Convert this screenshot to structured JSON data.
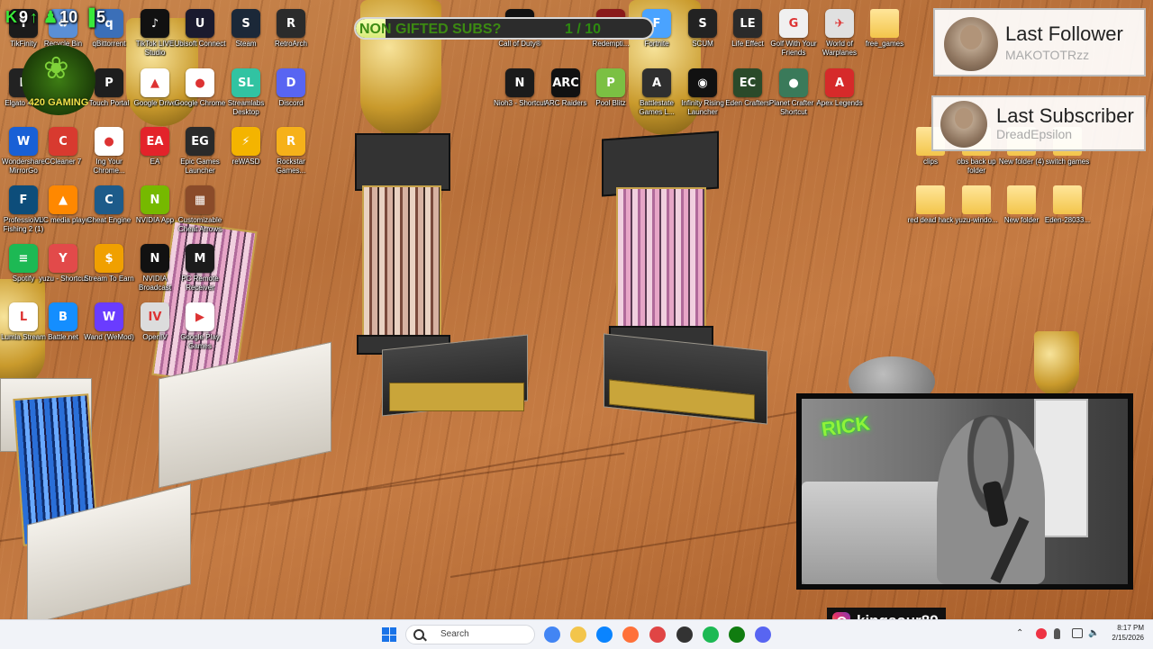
{
  "stream_stats": [
    {
      "symbol": "K",
      "value": "9",
      "icon": "up-arrow-icon"
    },
    {
      "symbol": "♟",
      "value": "10",
      "icon": "person-icon"
    },
    {
      "symbol": "▐",
      "value": "5",
      "icon": "bars-icon"
    }
  ],
  "sub_goal": {
    "title": "NON GIFTED SUBS?",
    "count_text": "1 / 10",
    "current": 1,
    "target": 10
  },
  "last_follower": {
    "heading": "Last Follower",
    "name": "MAKOTOTRzz"
  },
  "last_subscriber": {
    "heading": "Last Subscriber",
    "name": "DreadEpsilon"
  },
  "overlay_logo_text": "420 GAMING",
  "cam_tag": "RICK",
  "instagram": {
    "handle": "kingsour89"
  },
  "desktop_icons": [
    {
      "label": "TikFinity",
      "color": "#1b1b1b",
      "glyph": "T"
    },
    {
      "label": "Recycle Bin",
      "color": "#5a8fd6",
      "glyph": "♻"
    },
    {
      "label": "qBittorrent",
      "color": "#3b6fb8",
      "glyph": "q"
    },
    {
      "label": "TikTok LIVE Studio",
      "color": "#111111",
      "glyph": "♪"
    },
    {
      "label": "Ubisoft Connect",
      "color": "#1a1a2e",
      "glyph": "U"
    },
    {
      "label": "Steam",
      "color": "#1b2838",
      "glyph": "S"
    },
    {
      "label": "RetroArch",
      "color": "#2b2b2b",
      "glyph": "R"
    },
    {
      "label": "Elgato 4K...",
      "color": "#222222",
      "glyph": "E"
    },
    {
      "label": "Touch Portal",
      "color": "#1e1e1e",
      "glyph": "P"
    },
    {
      "label": "Google Drive",
      "color": "#ffffff",
      "glyph": "▲"
    },
    {
      "label": "Google Chrome",
      "color": "#ffffff",
      "glyph": "●"
    },
    {
      "label": "Streamlabs Desktop",
      "color": "#31c3a2",
      "glyph": "SL"
    },
    {
      "label": "Discord",
      "color": "#5865f2",
      "glyph": "D"
    },
    {
      "label": "Wondershare MirrorGo",
      "color": "#1860d6",
      "glyph": "W"
    },
    {
      "label": "CCleaner 7",
      "color": "#d83a2f",
      "glyph": "C"
    },
    {
      "label": "Ing Your Chrome...",
      "color": "#ffffff",
      "glyph": "●"
    },
    {
      "label": "EA",
      "color": "#e3232a",
      "glyph": "EA"
    },
    {
      "label": "Epic Games Launcher",
      "color": "#2a2a2a",
      "glyph": "EG"
    },
    {
      "label": "reWASD",
      "color": "#f4b400",
      "glyph": "⚡"
    },
    {
      "label": "Rockstar Games...",
      "color": "#f6b11a",
      "glyph": "R"
    },
    {
      "label": "Professional Fishing 2 (1)",
      "color": "#0d4d7a",
      "glyph": "F"
    },
    {
      "label": "VLC media player",
      "color": "#ff8800",
      "glyph": "▲"
    },
    {
      "label": "Cheat Engine",
      "color": "#1d5b8a",
      "glyph": "C"
    },
    {
      "label": "NVIDIA App",
      "color": "#76b900",
      "glyph": "N"
    },
    {
      "label": "Customizable Cheat Arrows",
      "color": "#8a4b2a",
      "glyph": "▦"
    },
    {
      "label": "Spotify",
      "color": "#1db954",
      "glyph": "≡"
    },
    {
      "label": "yuzu - Shortcut",
      "color": "#e24a4a",
      "glyph": "Y"
    },
    {
      "label": "Stream To Earn",
      "color": "#f0a000",
      "glyph": "$"
    },
    {
      "label": "NVIDIA Broadcast",
      "color": "#111111",
      "glyph": "N"
    },
    {
      "label": "PC Remote Receiver",
      "color": "#1b1b1b",
      "glyph": "M"
    },
    {
      "label": "Lumia Stream",
      "color": "#ffffff",
      "glyph": "L"
    },
    {
      "label": "Battle.net",
      "color": "#148eff",
      "glyph": "B"
    },
    {
      "label": "Wand (WeMod)",
      "color": "#6a3cff",
      "glyph": "W"
    },
    {
      "label": "OpenIV",
      "color": "#dcdcdc",
      "glyph": "IV"
    },
    {
      "label": "Google Play Games",
      "color": "#ffffff",
      "glyph": "▶"
    },
    {
      "label": "Call of Duty®",
      "color": "#111111",
      "glyph": "CoD"
    },
    {
      "label": "Redempti...",
      "color": "#8a1a1a",
      "glyph": "R"
    },
    {
      "label": "Fortnite",
      "color": "#4aa3ff",
      "glyph": "F"
    },
    {
      "label": "SCUM",
      "color": "#222222",
      "glyph": "S"
    },
    {
      "label": "Life Effect",
      "color": "#2a2a2a",
      "glyph": "LE"
    },
    {
      "label": "Golf With Your Friends",
      "color": "#f0f0f0",
      "glyph": "G"
    },
    {
      "label": "World of Warplanes",
      "color": "#e0e0e0",
      "glyph": "✈"
    },
    {
      "label": "free_games",
      "color": "#f3c54b",
      "glyph": ""
    },
    {
      "label": "Nioh3 - Shortcut",
      "color": "#1b1b1b",
      "glyph": "N"
    },
    {
      "label": "ARC Raiders",
      "color": "#111111",
      "glyph": "ARC"
    },
    {
      "label": "Pool Blitz",
      "color": "#7bc043",
      "glyph": "P"
    },
    {
      "label": "Battlestate Games L...",
      "color": "#2f2f2f",
      "glyph": "A"
    },
    {
      "label": "Infinity Rising Launcher",
      "color": "#111111",
      "glyph": "◉"
    },
    {
      "label": "Eden Crafters",
      "color": "#2a4a2a",
      "glyph": "EC"
    },
    {
      "label": "Planet Crafter - Shortcut",
      "color": "#3a7a5a",
      "glyph": "●"
    },
    {
      "label": "Apex Legends",
      "color": "#d62a2a",
      "glyph": "A"
    },
    {
      "label": "clips",
      "color": "#f3c54b",
      "glyph": ""
    },
    {
      "label": "obs back up folder",
      "color": "#f3c54b",
      "glyph": ""
    },
    {
      "label": "New folder (4)",
      "color": "#f3c54b",
      "glyph": ""
    },
    {
      "label": "switch games",
      "color": "#f3c54b",
      "glyph": ""
    },
    {
      "label": "red dead hack",
      "color": "#f3c54b",
      "glyph": ""
    },
    {
      "label": "yuzu-windo...",
      "color": "#f3c54b",
      "glyph": ""
    },
    {
      "label": "New folder",
      "color": "#f3c54b",
      "glyph": ""
    },
    {
      "label": "Eden-28033...",
      "color": "#f3c54b",
      "glyph": ""
    }
  ],
  "taskbar": {
    "search_placeholder": "Search",
    "apps": [
      {
        "name": "chrome-taskbar-icon",
        "color": "#4285f4"
      },
      {
        "name": "file-explorer-taskbar-icon",
        "color": "#f3c54b"
      },
      {
        "name": "messenger-taskbar-icon",
        "color": "#0a84ff"
      },
      {
        "name": "firefox-taskbar-icon",
        "color": "#ff7139"
      },
      {
        "name": "maps-taskbar-icon",
        "color": "#e04545"
      },
      {
        "name": "app-taskbar-icon",
        "color": "#333333"
      },
      {
        "name": "spotify-taskbar-icon",
        "color": "#1db954"
      },
      {
        "name": "xbox-taskbar-icon",
        "color": "#107c10"
      },
      {
        "name": "discord-taskbar-icon",
        "color": "#5865f2"
      }
    ],
    "time": "8:17 PM",
    "date": "2/15/2026"
  }
}
